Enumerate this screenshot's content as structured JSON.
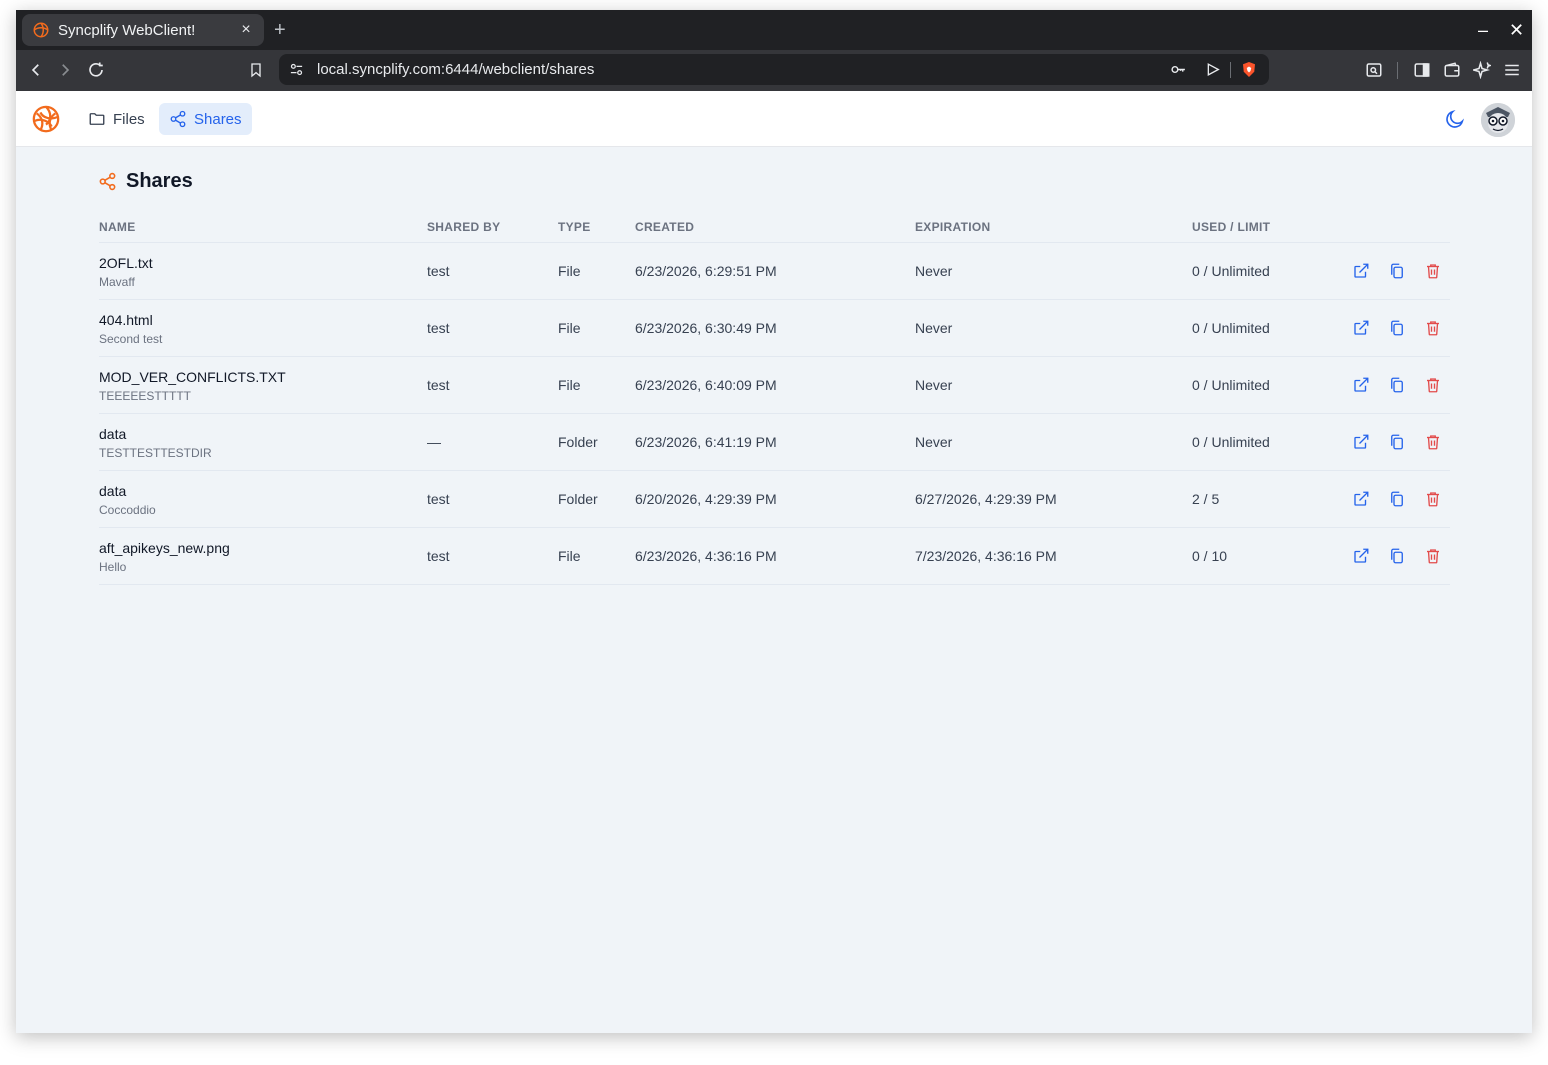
{
  "browser": {
    "tab_title": "Syncplify WebClient!",
    "tab_close": "×",
    "new_tab": "+",
    "minimize": "–",
    "close": "✕",
    "url": "local.syncplify.com:6444/webclient/shares"
  },
  "nav": {
    "files": "Files",
    "shares": "Shares"
  },
  "page": {
    "title": "Shares"
  },
  "table": {
    "headers": {
      "name": "NAME",
      "shared_by": "SHARED BY",
      "type": "TYPE",
      "created": "CREATED",
      "expiration": "EXPIRATION",
      "used_limit": "USED / LIMIT"
    },
    "rows": [
      {
        "name": "2OFL.txt",
        "desc": "Mavaff",
        "shared_by": "test",
        "type": "File",
        "created": "6/23/2026, 6:29:51 PM",
        "expiration": "Never",
        "used": "0 / Unlimited"
      },
      {
        "name": "404.html",
        "desc": "Second test",
        "shared_by": "test",
        "type": "File",
        "created": "6/23/2026, 6:30:49 PM",
        "expiration": "Never",
        "used": "0 / Unlimited"
      },
      {
        "name": "MOD_VER_CONFLICTS.TXT",
        "desc": "TEEEEESTTTTT",
        "shared_by": "test",
        "type": "File",
        "created": "6/23/2026, 6:40:09 PM",
        "expiration": "Never",
        "used": "0 / Unlimited"
      },
      {
        "name": "data",
        "desc": "TESTTESTTESTDIR",
        "shared_by": "—",
        "type": "Folder",
        "created": "6/23/2026, 6:41:19 PM",
        "expiration": "Never",
        "used": "0 / Unlimited"
      },
      {
        "name": "data",
        "desc": "Coccoddio",
        "shared_by": "test",
        "type": "Folder",
        "created": "6/20/2026, 4:29:39 PM",
        "expiration": "6/27/2026, 4:29:39 PM",
        "used": "2 / 5"
      },
      {
        "name": "aft_apikeys_new.png",
        "desc": "Hello",
        "shared_by": "test",
        "type": "File",
        "created": "6/23/2026, 4:36:16 PM",
        "expiration": "7/23/2026, 4:36:16 PM",
        "used": "0 / 10"
      }
    ]
  },
  "colors": {
    "accent": "#2563eb",
    "brand": "#f26b1d",
    "danger": "#e24b4b"
  },
  "icons": {
    "open": "external-link-icon",
    "copy": "copy-icon",
    "delete": "trash-icon"
  }
}
